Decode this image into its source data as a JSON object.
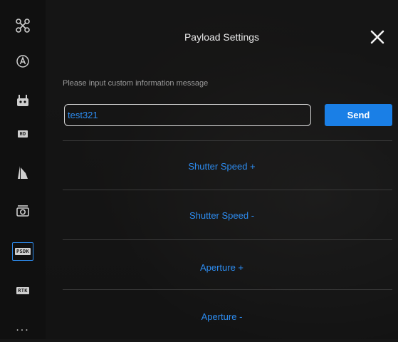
{
  "sidebar": {
    "items": [
      {
        "icon": "drone-icon",
        "active": false
      },
      {
        "icon": "flight-mode-icon",
        "active": false
      },
      {
        "icon": "robot-icon",
        "active": false
      },
      {
        "icon": "hd-icon",
        "badge": "HD",
        "active": false
      },
      {
        "icon": "map-icon",
        "active": false
      },
      {
        "icon": "camera-icon",
        "active": false
      },
      {
        "icon": "psdk-icon",
        "badge": "PSDK",
        "active": true
      },
      {
        "icon": "rtk-icon",
        "badge": "RTK",
        "active": false
      },
      {
        "icon": "more-icon",
        "label": "...",
        "active": false
      }
    ],
    "active_color": "#2d8cf0"
  },
  "panel": {
    "title": "Payload Settings",
    "prompt": "Please input custom information message",
    "input_value": "test321",
    "send_label": "Send",
    "actions": [
      {
        "label": "Shutter Speed +"
      },
      {
        "label": "Shutter Speed -"
      },
      {
        "label": "Aperture +"
      },
      {
        "label": "Aperture -"
      }
    ]
  },
  "colors": {
    "accent": "#2d8cf0",
    "send_button": "#1a7fe6",
    "text": "#e9e9e9"
  }
}
